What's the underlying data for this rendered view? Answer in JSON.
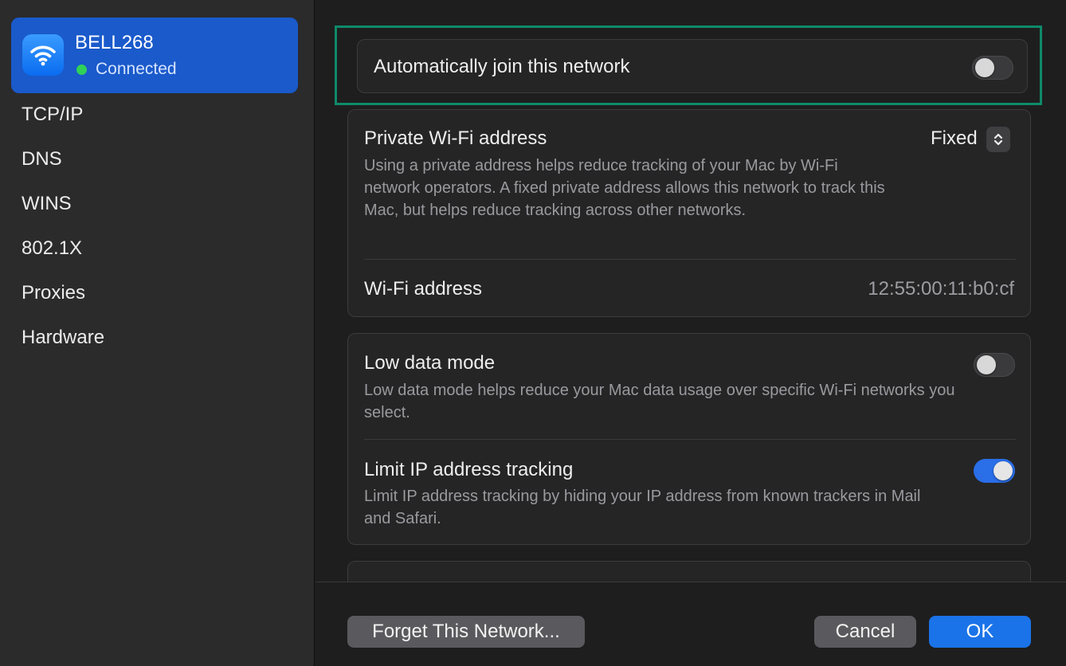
{
  "sidebar": {
    "network": {
      "name": "BELL268",
      "status": "Connected"
    },
    "items": [
      {
        "label": "TCP/IP"
      },
      {
        "label": "DNS"
      },
      {
        "label": "WINS"
      },
      {
        "label": "802.1X"
      },
      {
        "label": "Proxies"
      },
      {
        "label": "Hardware"
      }
    ]
  },
  "settings": {
    "auto_join": {
      "label": "Automatically join this network",
      "enabled": false
    },
    "private_address": {
      "label": "Private Wi-Fi address",
      "value": "Fixed",
      "description": "Using a private address helps reduce tracking of your Mac by Wi-Fi network operators. A fixed private address allows this network to track this Mac, but helps reduce tracking across other networks."
    },
    "wifi_address": {
      "label": "Wi-Fi address",
      "value": "12:55:00:11:b0:cf"
    },
    "low_data_mode": {
      "label": "Low data mode",
      "description": "Low data mode helps reduce your Mac data usage over specific Wi-Fi networks you select.",
      "enabled": false
    },
    "limit_ip_tracking": {
      "label": "Limit IP address tracking",
      "description": "Limit IP address tracking by hiding your IP address from known trackers in Mail and Safari.",
      "enabled": true
    }
  },
  "buttons": {
    "forget": "Forget This Network...",
    "cancel": "Cancel",
    "ok": "OK"
  },
  "colors": {
    "accent": "#1a73e8",
    "selection": "#1a5acb",
    "connected": "#30d158",
    "highlight_frame": "#0f8a6a"
  },
  "icons": {
    "network": "wifi-icon",
    "stepper": "up-down-chevron-icon"
  }
}
